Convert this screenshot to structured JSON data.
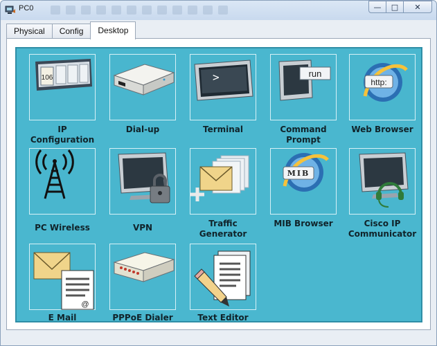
{
  "window": {
    "title": "PC0",
    "minimize_glyph": "—",
    "maximize_glyph": "□",
    "close_glyph": "✕"
  },
  "tabs": [
    {
      "label": "Physical",
      "active": false
    },
    {
      "label": "Config",
      "active": false
    },
    {
      "label": "Desktop",
      "active": true
    }
  ],
  "apps": [
    {
      "label": "IP\nConfiguration",
      "icon": "ip-configuration-icon",
      "icon_text": "106"
    },
    {
      "label": "Dial-up",
      "icon": "modem-icon"
    },
    {
      "label": "Terminal",
      "icon": "terminal-icon",
      "icon_text": ">"
    },
    {
      "label": "Command\nPrompt",
      "icon": "command-prompt-icon",
      "icon_text": "run"
    },
    {
      "label": "Web Browser",
      "icon": "web-browser-icon",
      "icon_text": "http:"
    },
    {
      "label": "PC Wireless",
      "icon": "wireless-tower-icon"
    },
    {
      "label": "VPN",
      "icon": "vpn-lock-icon"
    },
    {
      "label": "Traffic\nGenerator",
      "icon": "traffic-generator-icon"
    },
    {
      "label": "MIB Browser",
      "icon": "mib-browser-icon",
      "icon_text": "MIB"
    },
    {
      "label": "Cisco IP\nCommunicator",
      "icon": "ip-communicator-icon"
    },
    {
      "label": "E Mail",
      "icon": "email-icon",
      "icon_text": "@"
    },
    {
      "label": "PPPoE Dialer",
      "icon": "pppoe-dialer-icon"
    },
    {
      "label": "Text Editor",
      "icon": "text-editor-icon"
    }
  ],
  "colors": {
    "desktop_bg": "#4ab7cf",
    "desktop_border": "#2f8ea6"
  }
}
